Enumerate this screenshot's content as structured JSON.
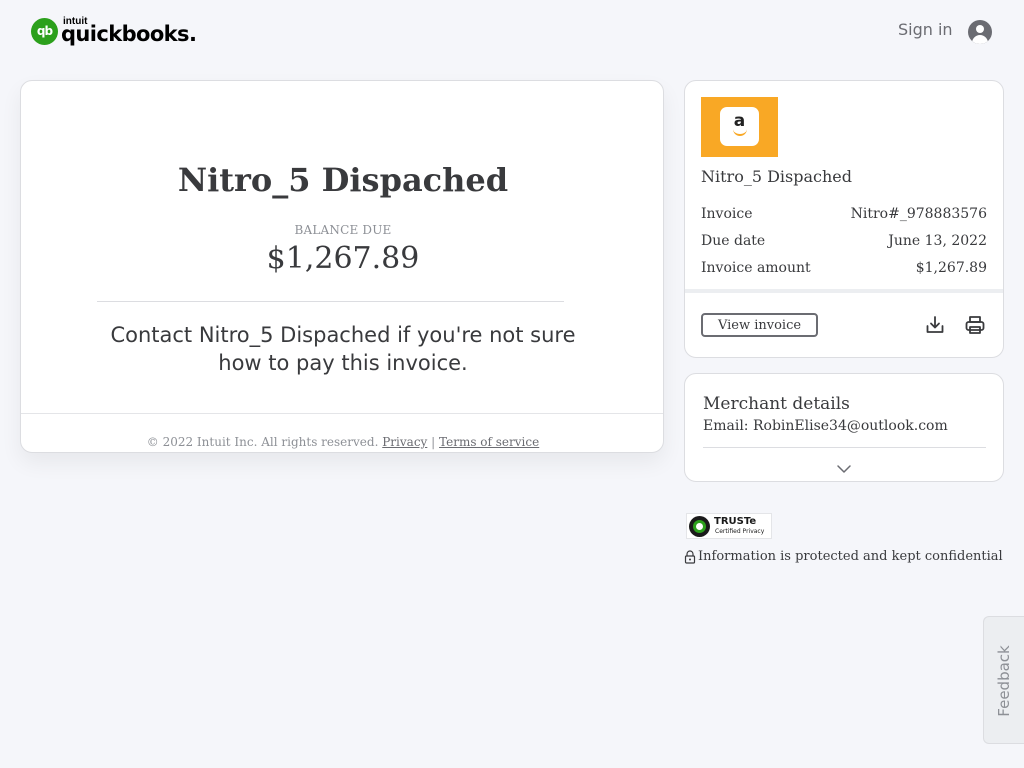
{
  "header": {
    "logo_intuit": "intuit",
    "logo_brand": "quickbooks.",
    "logo_mark": "qb",
    "signin_label": "Sign in",
    "avatar_icon": "user-avatar-icon"
  },
  "main": {
    "title": "Nitro_5 Dispached",
    "balance_label": "BALANCE DUE",
    "balance_amount": "$1,267.89",
    "contact_message": "Contact Nitro_5 Dispached if you're not sure how to pay this invoice.",
    "footer": {
      "copyright": "© 2022 Intuit Inc. All rights reserved.",
      "privacy_label": "Privacy",
      "separator": "|",
      "terms_label": "Terms of service"
    }
  },
  "summary": {
    "merchant_logo_letter": "a",
    "merchant_name": "Nitro_5 Dispached",
    "rows": [
      {
        "label": "Invoice",
        "value": "Nitro#_978883576"
      },
      {
        "label": "Due date",
        "value": "June 13, 2022"
      },
      {
        "label": "Invoice amount",
        "value": "$1,267.89"
      }
    ],
    "view_invoice_label": "View invoice",
    "download_icon": "download-icon",
    "print_icon": "print-icon"
  },
  "merchant_details": {
    "title": "Merchant details",
    "email_label": "Email:",
    "email_value": "RobinElise34@outlook.com",
    "expand_icon": "chevron-down-icon"
  },
  "trust": {
    "badge_name": "TRUSTe",
    "badge_sub": "Certified Privacy",
    "protected_text": "Information is protected and kept confidential"
  },
  "feedback": {
    "label": "Feedback"
  },
  "colors": {
    "brand_green": "#2ca01c",
    "page_bg": "#f5f6fa",
    "text_primary": "#393a3d",
    "text_muted": "#8d9096",
    "merchant_logo_bg": "#f9a825"
  }
}
